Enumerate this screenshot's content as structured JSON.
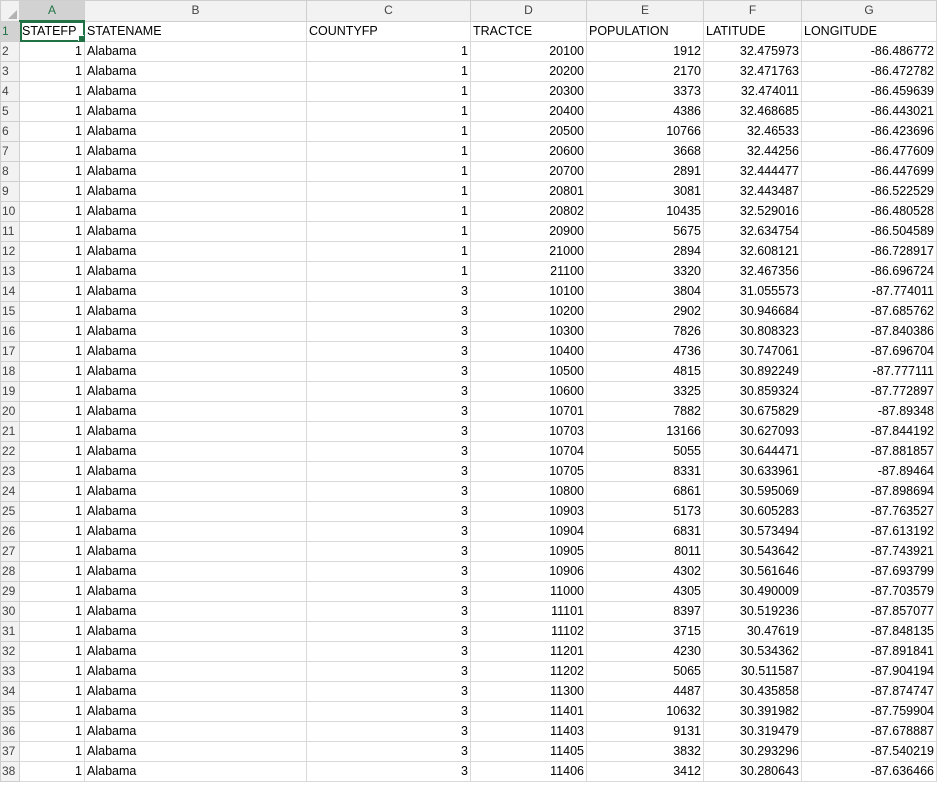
{
  "columns": [
    "A",
    "B",
    "C",
    "D",
    "E",
    "F",
    "G"
  ],
  "rows": [
    {
      "n": "1",
      "cells": [
        "STATEFP",
        "STATENAME",
        "COUNTYFP",
        "TRACTCE",
        "POPULATION",
        "LATITUDE",
        "LONGITUDE"
      ]
    },
    {
      "n": "2",
      "cells": [
        "1",
        "Alabama",
        "1",
        "20100",
        "1912",
        "32.475973",
        "-86.486772"
      ]
    },
    {
      "n": "3",
      "cells": [
        "1",
        "Alabama",
        "1",
        "20200",
        "2170",
        "32.471763",
        "-86.472782"
      ]
    },
    {
      "n": "4",
      "cells": [
        "1",
        "Alabama",
        "1",
        "20300",
        "3373",
        "32.474011",
        "-86.459639"
      ]
    },
    {
      "n": "5",
      "cells": [
        "1",
        "Alabama",
        "1",
        "20400",
        "4386",
        "32.468685",
        "-86.443021"
      ]
    },
    {
      "n": "6",
      "cells": [
        "1",
        "Alabama",
        "1",
        "20500",
        "10766",
        "32.46533",
        "-86.423696"
      ]
    },
    {
      "n": "7",
      "cells": [
        "1",
        "Alabama",
        "1",
        "20600",
        "3668",
        "32.44256",
        "-86.477609"
      ]
    },
    {
      "n": "8",
      "cells": [
        "1",
        "Alabama",
        "1",
        "20700",
        "2891",
        "32.444477",
        "-86.447699"
      ]
    },
    {
      "n": "9",
      "cells": [
        "1",
        "Alabama",
        "1",
        "20801",
        "3081",
        "32.443487",
        "-86.522529"
      ]
    },
    {
      "n": "10",
      "cells": [
        "1",
        "Alabama",
        "1",
        "20802",
        "10435",
        "32.529016",
        "-86.480528"
      ]
    },
    {
      "n": "11",
      "cells": [
        "1",
        "Alabama",
        "1",
        "20900",
        "5675",
        "32.634754",
        "-86.504589"
      ]
    },
    {
      "n": "12",
      "cells": [
        "1",
        "Alabama",
        "1",
        "21000",
        "2894",
        "32.608121",
        "-86.728917"
      ]
    },
    {
      "n": "13",
      "cells": [
        "1",
        "Alabama",
        "1",
        "21100",
        "3320",
        "32.467356",
        "-86.696724"
      ]
    },
    {
      "n": "14",
      "cells": [
        "1",
        "Alabama",
        "3",
        "10100",
        "3804",
        "31.055573",
        "-87.774011"
      ]
    },
    {
      "n": "15",
      "cells": [
        "1",
        "Alabama",
        "3",
        "10200",
        "2902",
        "30.946684",
        "-87.685762"
      ]
    },
    {
      "n": "16",
      "cells": [
        "1",
        "Alabama",
        "3",
        "10300",
        "7826",
        "30.808323",
        "-87.840386"
      ]
    },
    {
      "n": "17",
      "cells": [
        "1",
        "Alabama",
        "3",
        "10400",
        "4736",
        "30.747061",
        "-87.696704"
      ]
    },
    {
      "n": "18",
      "cells": [
        "1",
        "Alabama",
        "3",
        "10500",
        "4815",
        "30.892249",
        "-87.777111"
      ]
    },
    {
      "n": "19",
      "cells": [
        "1",
        "Alabama",
        "3",
        "10600",
        "3325",
        "30.859324",
        "-87.772897"
      ]
    },
    {
      "n": "20",
      "cells": [
        "1",
        "Alabama",
        "3",
        "10701",
        "7882",
        "30.675829",
        "-87.89348"
      ]
    },
    {
      "n": "21",
      "cells": [
        "1",
        "Alabama",
        "3",
        "10703",
        "13166",
        "30.627093",
        "-87.844192"
      ]
    },
    {
      "n": "22",
      "cells": [
        "1",
        "Alabama",
        "3",
        "10704",
        "5055",
        "30.644471",
        "-87.881857"
      ]
    },
    {
      "n": "23",
      "cells": [
        "1",
        "Alabama",
        "3",
        "10705",
        "8331",
        "30.633961",
        "-87.89464"
      ]
    },
    {
      "n": "24",
      "cells": [
        "1",
        "Alabama",
        "3",
        "10800",
        "6861",
        "30.595069",
        "-87.898694"
      ]
    },
    {
      "n": "25",
      "cells": [
        "1",
        "Alabama",
        "3",
        "10903",
        "5173",
        "30.605283",
        "-87.763527"
      ]
    },
    {
      "n": "26",
      "cells": [
        "1",
        "Alabama",
        "3",
        "10904",
        "6831",
        "30.573494",
        "-87.613192"
      ]
    },
    {
      "n": "27",
      "cells": [
        "1",
        "Alabama",
        "3",
        "10905",
        "8011",
        "30.543642",
        "-87.743921"
      ]
    },
    {
      "n": "28",
      "cells": [
        "1",
        "Alabama",
        "3",
        "10906",
        "4302",
        "30.561646",
        "-87.693799"
      ]
    },
    {
      "n": "29",
      "cells": [
        "1",
        "Alabama",
        "3",
        "11000",
        "4305",
        "30.490009",
        "-87.703579"
      ]
    },
    {
      "n": "30",
      "cells": [
        "1",
        "Alabama",
        "3",
        "11101",
        "8397",
        "30.519236",
        "-87.857077"
      ]
    },
    {
      "n": "31",
      "cells": [
        "1",
        "Alabama",
        "3",
        "11102",
        "3715",
        "30.47619",
        "-87.848135"
      ]
    },
    {
      "n": "32",
      "cells": [
        "1",
        "Alabama",
        "3",
        "11201",
        "4230",
        "30.534362",
        "-87.891841"
      ]
    },
    {
      "n": "33",
      "cells": [
        "1",
        "Alabama",
        "3",
        "11202",
        "5065",
        "30.511587",
        "-87.904194"
      ]
    },
    {
      "n": "34",
      "cells": [
        "1",
        "Alabama",
        "3",
        "11300",
        "4487",
        "30.435858",
        "-87.874747"
      ]
    },
    {
      "n": "35",
      "cells": [
        "1",
        "Alabama",
        "3",
        "11401",
        "10632",
        "30.391982",
        "-87.759904"
      ]
    },
    {
      "n": "36",
      "cells": [
        "1",
        "Alabama",
        "3",
        "11403",
        "9131",
        "30.319479",
        "-87.678887"
      ]
    },
    {
      "n": "37",
      "cells": [
        "1",
        "Alabama",
        "3",
        "11405",
        "3832",
        "30.293296",
        "-87.540219"
      ]
    },
    {
      "n": "38",
      "cells": [
        "1",
        "Alabama",
        "3",
        "11406",
        "3412",
        "30.280643",
        "-87.636466"
      ]
    }
  ],
  "accent_color": "#217346",
  "active_cell": "A1"
}
